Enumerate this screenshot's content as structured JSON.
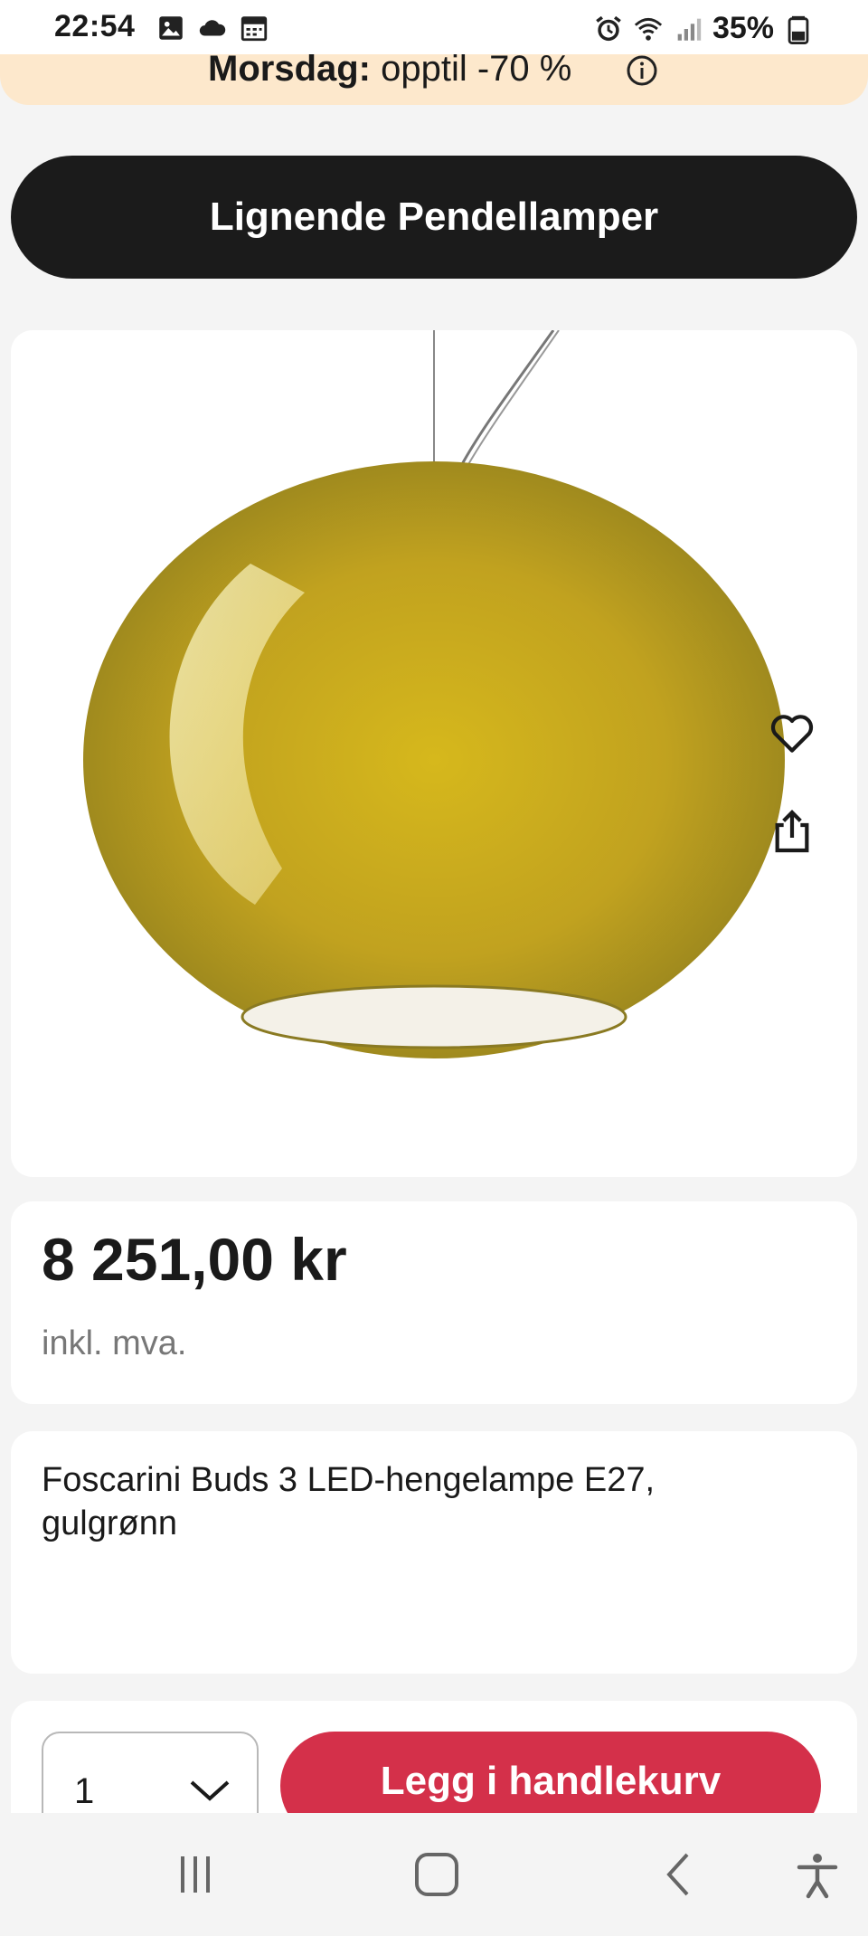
{
  "status_bar": {
    "time": "22:54",
    "battery_percent": "35%",
    "left_icons": [
      "gallery-icon",
      "cloud-icon",
      "calendar-icon"
    ],
    "right_icons": [
      "alarm-icon",
      "wifi-icon",
      "signal-icon",
      "battery-icon"
    ]
  },
  "promo": {
    "label": "Morsdag:",
    "text": "opptil -70 %",
    "icon": "info-icon"
  },
  "similar_button": {
    "label": "Lignende Pendellamper"
  },
  "product_image": {
    "icons": [
      "heart-icon",
      "share-icon"
    ],
    "lamp_color": "#c9b120"
  },
  "price": {
    "amount": "8 251,00 kr",
    "vat_note": "inkl. mva."
  },
  "product": {
    "title": "Foscarini Buds 3 LED-hengelampe E27, gulgrønn"
  },
  "cart": {
    "quantity": "1",
    "add_label": "Legg i handlekurv",
    "accent_color": "#d4304a"
  },
  "nav_bar": {
    "buttons": [
      "recent-apps-icon",
      "home-icon",
      "back-icon",
      "accessibility-icon"
    ]
  }
}
